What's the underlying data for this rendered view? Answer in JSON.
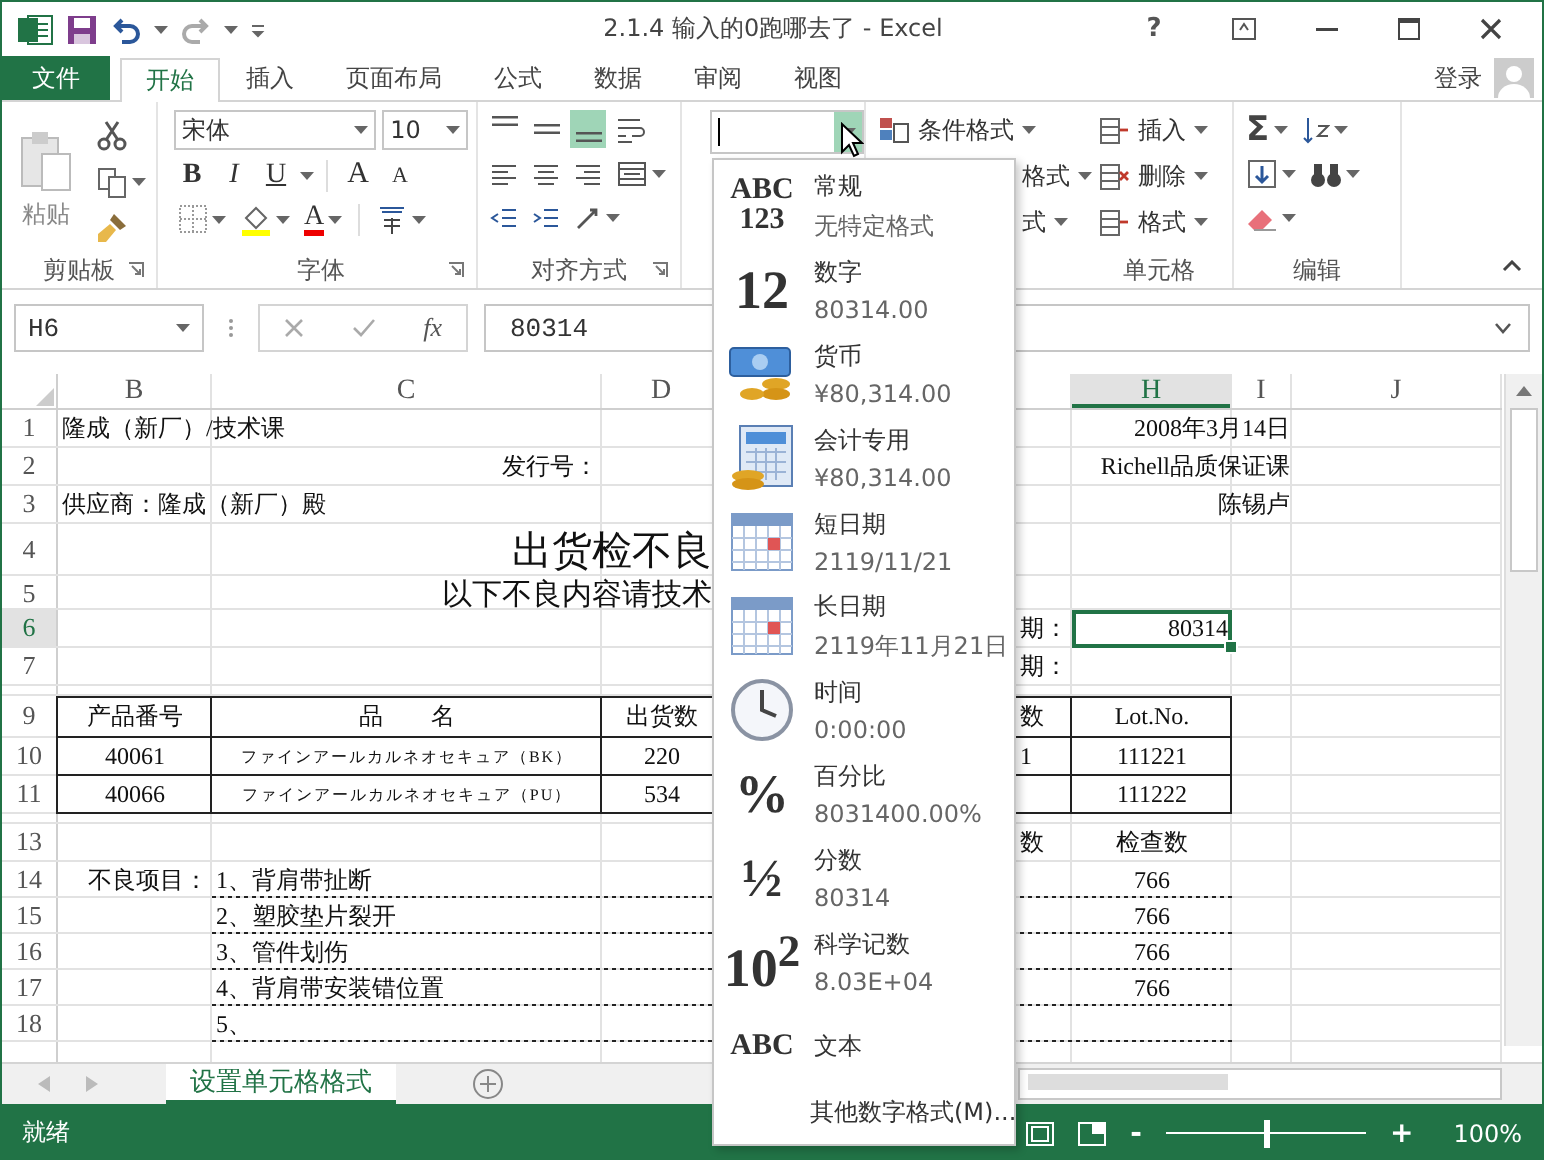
{
  "title_bar": {
    "title": "2.1.4 输入的0跑哪去了 - Excel",
    "help": "?"
  },
  "ribbon_tabs": [
    {
      "label": "文件",
      "kind": "file",
      "selected": false
    },
    {
      "label": "开始",
      "kind": "tab",
      "selected": true
    },
    {
      "label": "插入",
      "kind": "tab",
      "selected": false
    },
    {
      "label": "页面布局",
      "kind": "tab",
      "selected": false
    },
    {
      "label": "公式",
      "kind": "tab",
      "selected": false
    },
    {
      "label": "数据",
      "kind": "tab",
      "selected": false
    },
    {
      "label": "审阅",
      "kind": "tab",
      "selected": false
    },
    {
      "label": "视图",
      "kind": "tab",
      "selected": false
    }
  ],
  "account": {
    "label": "登录"
  },
  "clipboard": {
    "paste": "粘贴",
    "label": "剪贴板"
  },
  "font": {
    "name": "宋体",
    "size": "10",
    "bold": "B",
    "italic": "I",
    "underline": "U",
    "grow": "A",
    "shrink": "A",
    "color_letter": "A",
    "label": "字体"
  },
  "alignment": {
    "vertical": [
      {
        "selected": false
      },
      {
        "selected": false
      },
      {
        "selected": true
      }
    ],
    "label": "对齐方式"
  },
  "number_format": {
    "open": true
  },
  "styles": {
    "items": [
      "条件格式",
      "格式",
      "式"
    ]
  },
  "cells_group": {
    "items": [
      "插入",
      "删除",
      "格式"
    ],
    "label": "单元格"
  },
  "editing": {
    "sum": "Σ",
    "label": "编辑"
  },
  "formula_bar": {
    "name_box": "H6",
    "fx": "fx",
    "value": "80314"
  },
  "columns": [
    {
      "label": "B",
      "selected": false
    },
    {
      "label": "C",
      "selected": false
    },
    {
      "label": "D",
      "selected": false
    },
    {
      "label": "H",
      "selected": true
    },
    {
      "label": "I",
      "selected": false
    },
    {
      "label": "J",
      "selected": false
    }
  ],
  "rows": [
    {
      "label": "1",
      "kind": "info",
      "selected": false,
      "b": "隆成（新厂）/技术课",
      "h": "2008年3月14日"
    },
    {
      "label": "2",
      "kind": "info",
      "selected": false,
      "c": "发行号：",
      "h": "Richell品质保证课"
    },
    {
      "label": "3",
      "kind": "info",
      "selected": false,
      "b": "供应商：隆成（新厂）殿",
      "h": "陈锡卢"
    },
    {
      "label": "4",
      "kind": "banner",
      "selected": false,
      "c": "出货检不良"
    },
    {
      "label": "5",
      "kind": "subbanner",
      "selected": false,
      "c": "以下不良内容请技术"
    },
    {
      "label": "6",
      "kind": "field",
      "selected": true,
      "g": "期：",
      "h": "80314"
    },
    {
      "label": "7",
      "kind": "field",
      "selected": false,
      "g": "期："
    },
    {
      "kind": "gap"
    },
    {
      "label": "9",
      "kind": "thead",
      "selected": false,
      "b": "产品番号",
      "c": "品　　名",
      "d": "出货数",
      "g": "数",
      "h": "Lot.No."
    },
    {
      "label": "10",
      "kind": "tbody",
      "selected": false,
      "b": "40061",
      "c": "ファインアールカルネオセキュア（BK）",
      "d": "220",
      "g": "1",
      "h": "111221"
    },
    {
      "label": "11",
      "kind": "tbody",
      "selected": false,
      "b": "40066",
      "c": "ファインアールカルネオセキュア（PU）",
      "d": "534",
      "h": "111222"
    },
    {
      "kind": "gap"
    },
    {
      "label": "13",
      "kind": "subhead",
      "selected": false,
      "g": "数",
      "h": "检查数"
    },
    {
      "label": "14",
      "kind": "defect",
      "selected": false,
      "b": "不良项目：",
      "c": "1、背肩带扯断",
      "h": "766"
    },
    {
      "label": "15",
      "kind": "defect",
      "selected": false,
      "c": "2、塑胶垫片裂开",
      "h": "766"
    },
    {
      "label": "16",
      "kind": "defect",
      "selected": false,
      "c": "3、管件划伤",
      "h": "766"
    },
    {
      "label": "17",
      "kind": "defect",
      "selected": false,
      "c": "4、背肩带安装错位置",
      "h": "766"
    },
    {
      "label": "18",
      "kind": "defect",
      "selected": false,
      "c": "5、"
    }
  ],
  "format_menu": {
    "items": [
      {
        "name": "常规",
        "example": "无特定格式",
        "kind": "glyph_small",
        "glyph": [
          "ABC",
          "123"
        ]
      },
      {
        "name": "数字",
        "example": "80314.00",
        "kind": "glyph",
        "glyph": [
          "12"
        ]
      },
      {
        "name": "货币",
        "example": "¥80,314.00",
        "kind": "currency"
      },
      {
        "name": "会计专用",
        "example": "¥80,314.00",
        "kind": "accounting"
      },
      {
        "name": "短日期",
        "example": "2119/11/21",
        "kind": "calendar"
      },
      {
        "name": "长日期",
        "example": "2119年11月21日",
        "kind": "calendar"
      },
      {
        "name": "时间",
        "example": "0:00:00",
        "kind": "clock"
      },
      {
        "name": "百分比",
        "example": "8031400.00%",
        "kind": "glyph",
        "glyph": [
          "%"
        ]
      },
      {
        "name": "分数",
        "example": "80314",
        "kind": "glyph",
        "glyph": [
          "½"
        ]
      },
      {
        "name": "科学记数",
        "example": "8.03E+04",
        "kind": "glyph",
        "glyph": [
          "10$^{2}$"
        ]
      },
      {
        "name": "文本",
        "kind": "glyph_small",
        "glyph": [
          "ABC"
        ]
      }
    ],
    "more": "其他数字格式(M)..."
  },
  "sheet_tabs": [
    {
      "label": "设置单元格格式",
      "selected": true
    }
  ],
  "status_bar": {
    "status": "就绪",
    "zoom_out": "-",
    "zoom_in": "+",
    "zoom": {
      "level": 0.5,
      "reading": "100%"
    }
  }
}
